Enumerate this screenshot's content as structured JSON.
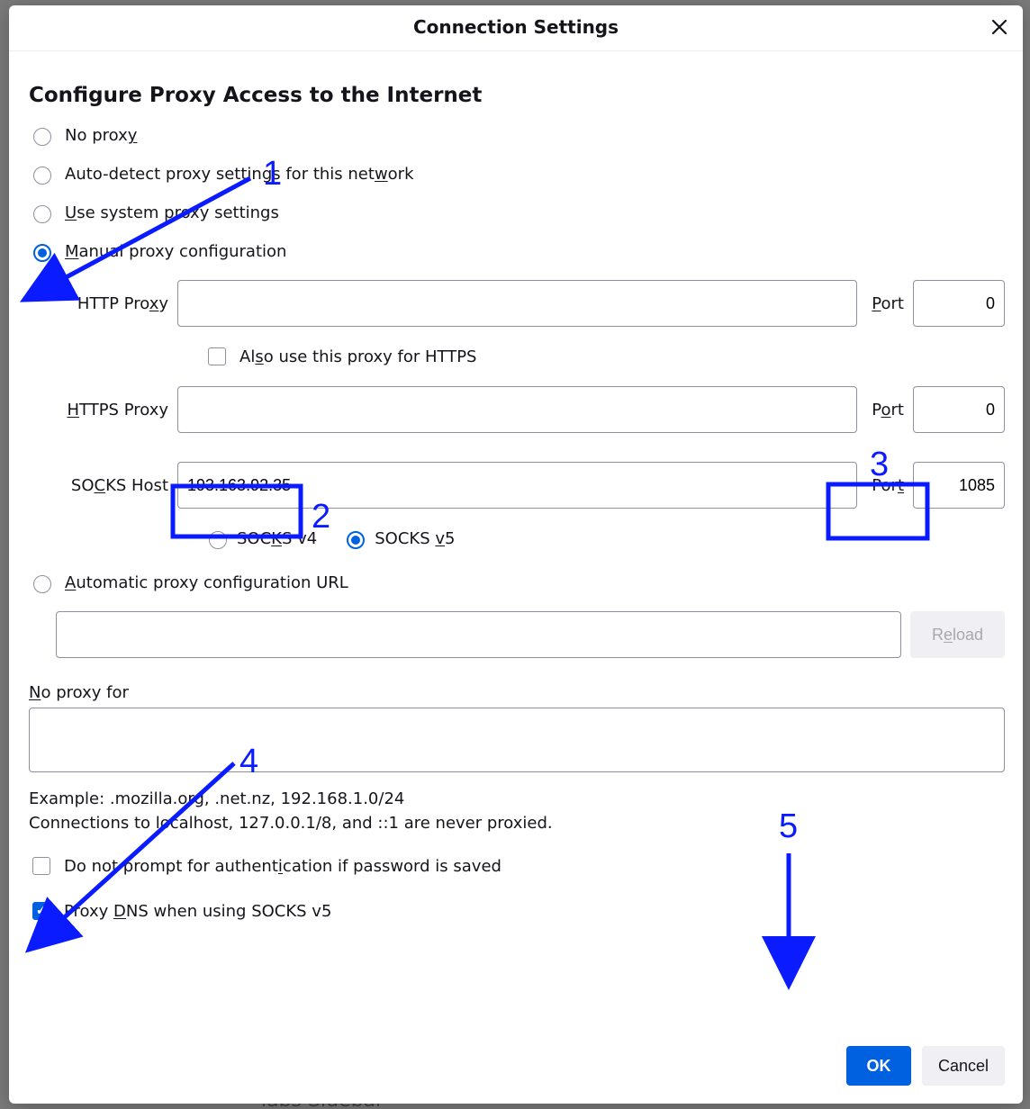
{
  "dialog": {
    "title": "Connection Settings",
    "close_icon": "close-icon"
  },
  "section_title": "Configure Proxy Access to the Internet",
  "radios": {
    "no_proxy": {
      "pre": "No prox",
      "u": "y",
      "post": ""
    },
    "auto_detect": {
      "pre": "Auto-detect proxy settings for this net",
      "u": "w",
      "post": "ork"
    },
    "system": {
      "pre": "",
      "u": "U",
      "post": "se system proxy settings"
    },
    "manual": {
      "pre": "",
      "u": "M",
      "post": "anual proxy configuration"
    },
    "auto_url": {
      "pre": "",
      "u": "A",
      "post": "utomatic proxy configuration URL"
    }
  },
  "http": {
    "label": "HTTP Proxy",
    "label_pre": "HTTP Pro",
    "label_u": "x",
    "label_post": "y",
    "value": "",
    "port_label_pre": "",
    "port_label_u": "P",
    "port_label_post": "ort",
    "port": "0"
  },
  "https_also": {
    "pre": "Al",
    "u": "s",
    "post": "o use this proxy for HTTPS"
  },
  "https": {
    "label_pre": "",
    "label_u": "H",
    "label_post": "TTPS Proxy",
    "value": "",
    "port_label_pre": "P",
    "port_label_u": "o",
    "port_label_post": "rt",
    "port": "0"
  },
  "socks": {
    "label_pre": "SO",
    "label_u": "C",
    "label_post": "KS Host",
    "value": "193.163.92.35",
    "port_label_pre": "Por",
    "port_label_u": "t",
    "port_label_post": "",
    "port": "1085"
  },
  "socks_v4": {
    "pre": "SOC",
    "u": "K",
    "post": "S v4"
  },
  "socks_v5": {
    "pre": "SOCKS ",
    "u": "v",
    "post": "5"
  },
  "reload_label": {
    "pre": "R",
    "u": "e",
    "post": "load"
  },
  "no_proxy_for": {
    "label_pre": "",
    "label_u": "N",
    "label_post": "o proxy for",
    "value": ""
  },
  "hint1": "Example: .mozilla.org, .net.nz, 192.168.1.0/24",
  "hint2": "Connections to localhost, 127.0.0.1/8, and ::1 are never proxied.",
  "auth_check": {
    "pre": "Do not prompt for authent",
    "u": "i",
    "post": "cation if password is saved"
  },
  "dns_check": {
    "pre": "Proxy ",
    "u": "D",
    "post": "NS when using SOCKS v5"
  },
  "buttons": {
    "ok": "OK",
    "cancel": "Cancel"
  },
  "annotations": {
    "n1": "1",
    "n2": "2",
    "n3": "3",
    "n4": "4",
    "n5": "5"
  },
  "bg_text": "labs Sidebar"
}
